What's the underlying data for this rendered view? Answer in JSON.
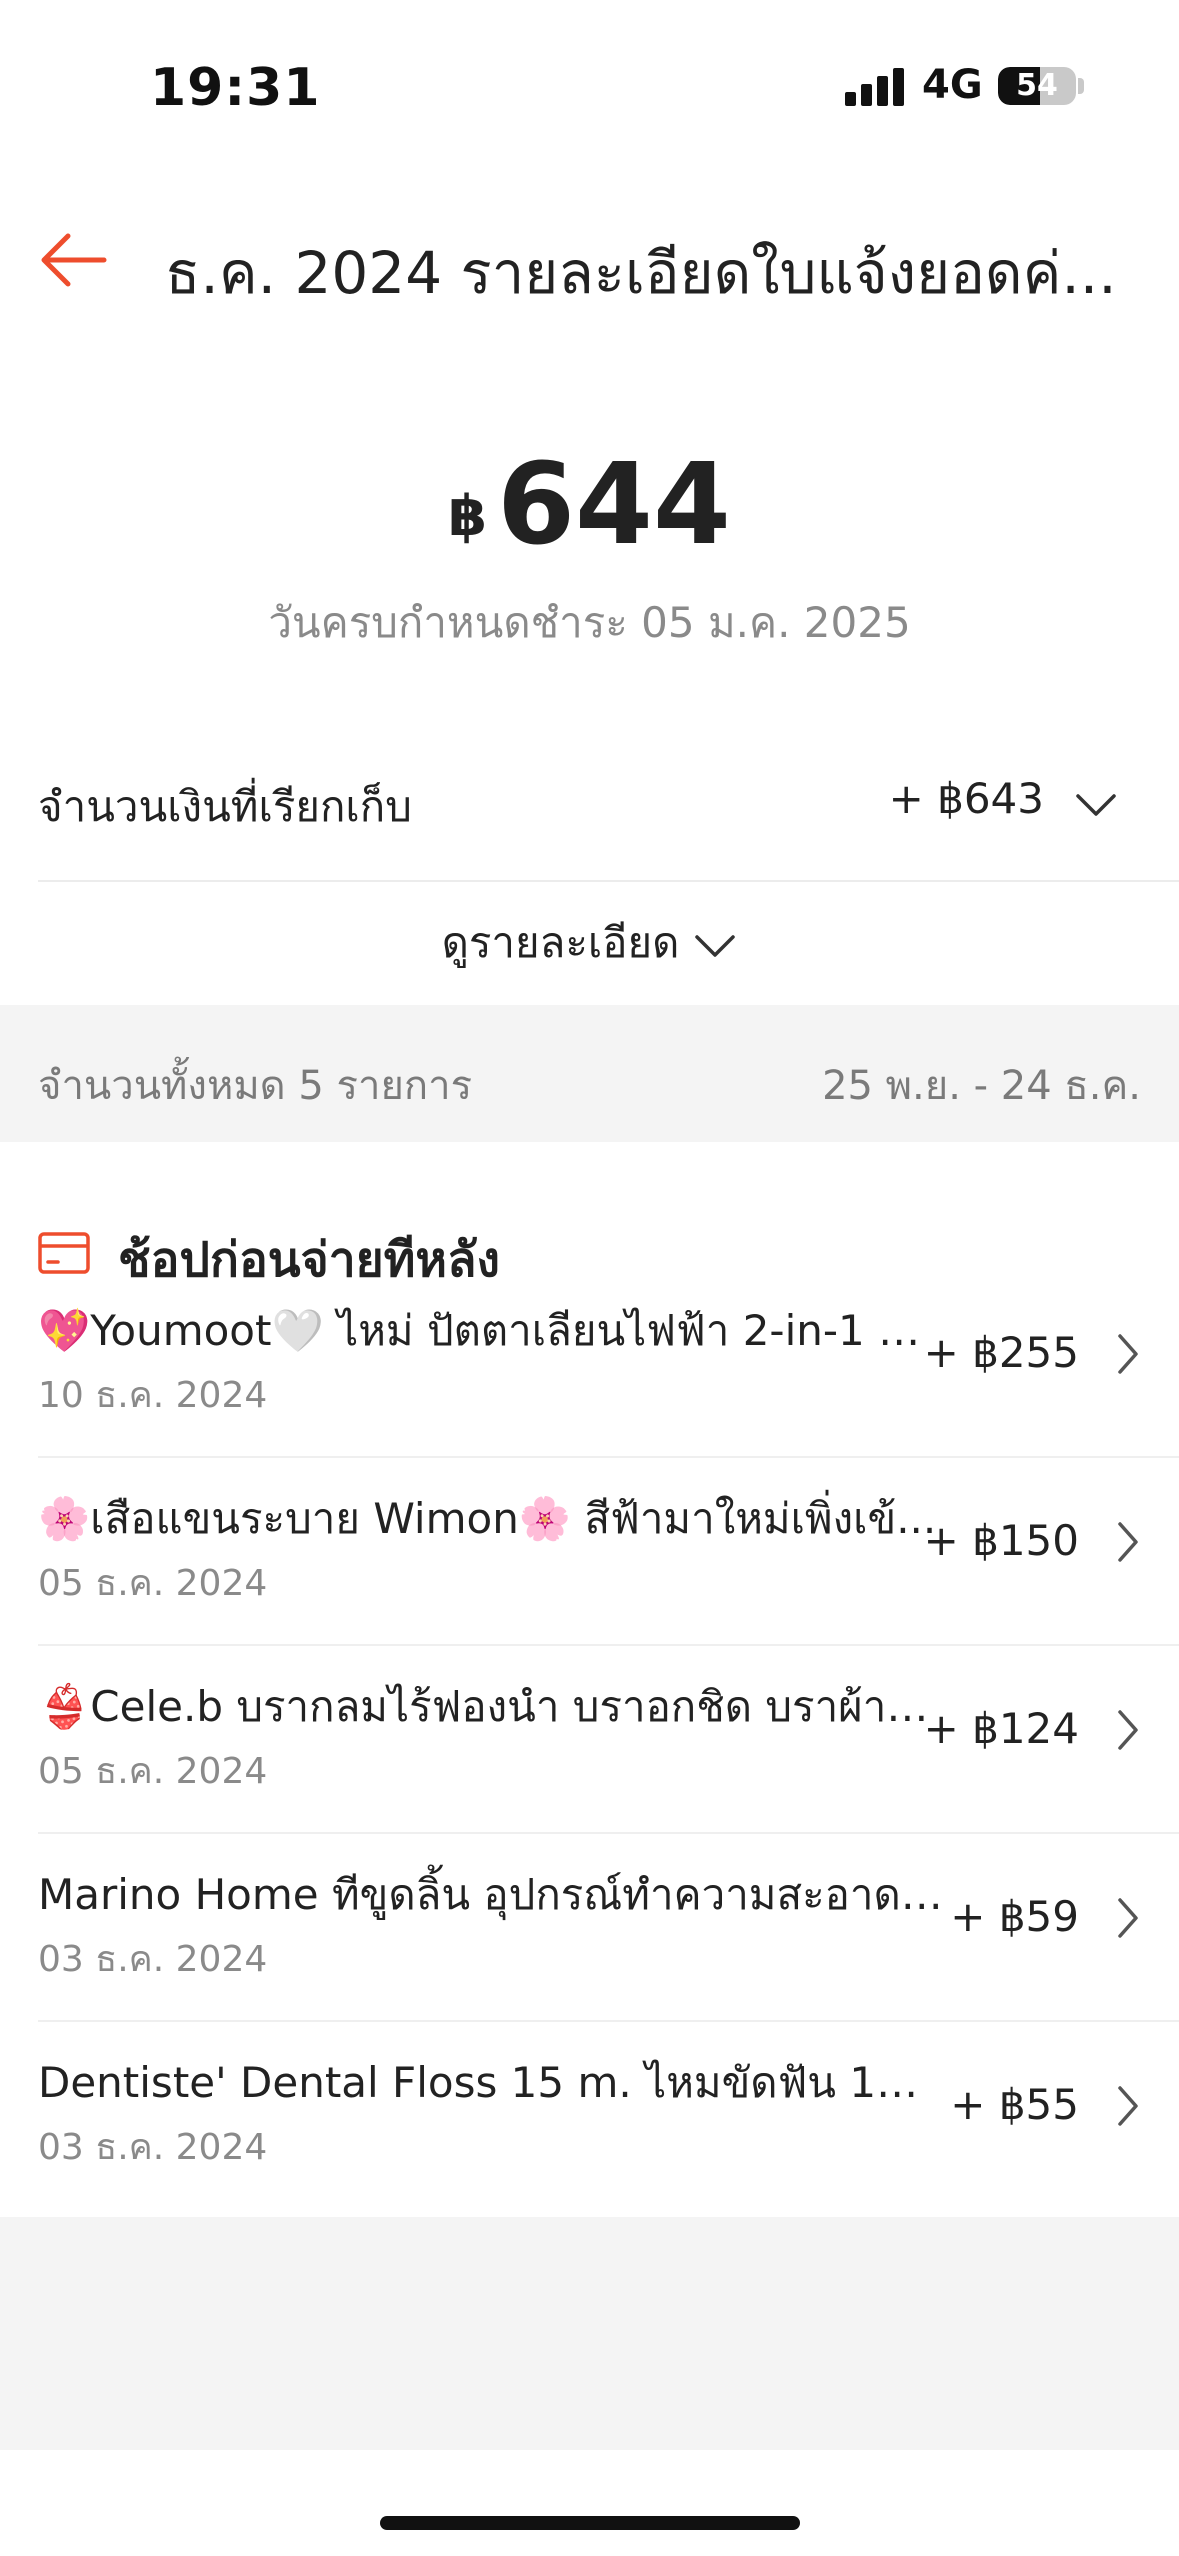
{
  "status": {
    "time": "19:31",
    "network": "4G",
    "battery": "54",
    "battery_level": 0.54
  },
  "header": {
    "title": "ธ.ค. 2024 รายละเอียดใบแจ้งยอดค่..."
  },
  "statement": {
    "currency": "฿",
    "amount": "644",
    "due": "วันครบกำหนดชำระ 05 ม.ค. 2025",
    "collected_label": "จำนวนเงินที่เรียกเก็บ",
    "collected_amount": "+ ฿643",
    "details_label": "ดูรายละเอียด"
  },
  "summary": {
    "count": "จำนวนทั้งหมด 5 รายการ",
    "range": "25 พ.ย. - 24 ธ.ค."
  },
  "section": {
    "title": "ช้อปก่อนจ่ายทีหลัง"
  },
  "transactions": [
    {
      "title": "💖Youmoot🤍 ไหม่ ปัตตาเลียนไฟฟ้า 2-in-1 ตั...",
      "date": "10 ธ.ค. 2024",
      "amount": "+ ฿255"
    },
    {
      "title": "🌸เสือแขนระบาย Wimon🌸 สีฟ้ามาใหม่เพิ่งเข้...",
      "date": "05 ธ.ค. 2024",
      "amount": "+ ฿150"
    },
    {
      "title": "👙Cele.b บรากลมไร้ฟองนำ บราอกชิด บราผ้า ...",
      "date": "05 ธ.ค. 2024",
      "amount": "+ ฿124"
    },
    {
      "title": "Marino Home ทีขูดลิ้น อุปกรณ์ทำความสะอาดลิ้น...",
      "date": "03 ธ.ค. 2024",
      "amount": "+ ฿59"
    },
    {
      "title": "Dentiste' Dental Floss 15 m. ไหมขัดฟัน 15 ม. ...",
      "date": "03 ธ.ค. 2024",
      "amount": "+ ฿55"
    }
  ],
  "colors": {
    "accent": "#ee4d2d",
    "text": "#222222",
    "muted": "#8a8a8a",
    "background": "#f4f4f4"
  }
}
